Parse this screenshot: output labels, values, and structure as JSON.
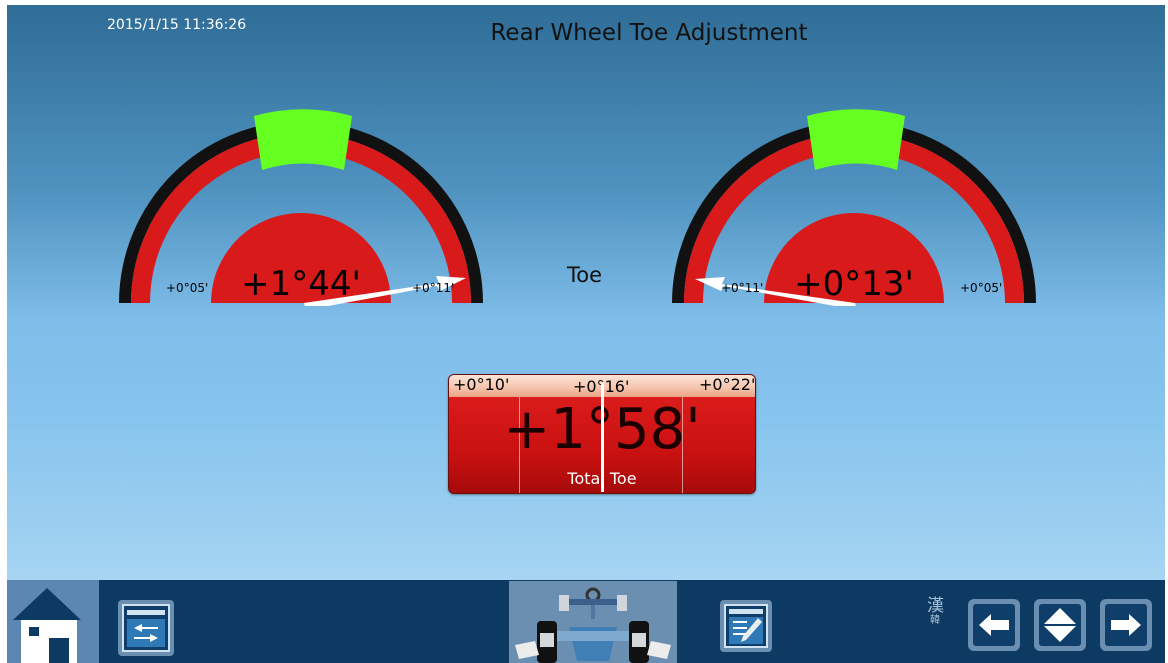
{
  "header": {
    "timestamp": "2015/1/15 11:36:26",
    "title": "Rear Wheel Toe Adjustment"
  },
  "left_gauge": {
    "value": "+1°44'",
    "min_label": "+0°05'",
    "max_label": "+0°11'"
  },
  "right_gauge": {
    "value": "+0°13'",
    "min_label": "+0°11'",
    "max_label": "+0°05'"
  },
  "center_label": "Toe",
  "total_toe": {
    "value": "+1°58'",
    "label": "Total Toe",
    "ticks": [
      "+0°10'",
      "+0°16'",
      "+0°22'"
    ]
  },
  "toolbar": {
    "lang_char": "漢",
    "lang_sub": "韓"
  },
  "colors": {
    "tolerance_green": "#66ff22",
    "gauge_red": "#d81a1a",
    "toolbar_bg": "#0d3a63"
  }
}
